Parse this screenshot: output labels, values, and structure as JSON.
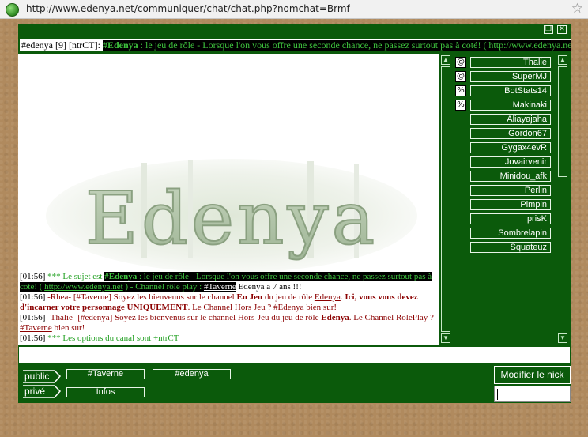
{
  "address_bar": {
    "url": "http://www.edenya.net/communiquer/chat/chat.php?nomchat=Brmf"
  },
  "window": {
    "restore_glyph": "❐",
    "close_glyph": "✕"
  },
  "topic": {
    "prefix": "#edenya [9] [ntrCT]: ",
    "channel": "#Edenya",
    "text": " : le jeu de rôle - Lorsque l'on vous offre une seconde chance, ne passez surtout pas à coté! ( http://www.edenya.net ) "
  },
  "logo": {
    "text": "Edenya"
  },
  "messages": {
    "m1": {
      "time": "[01:56]",
      "pre": " *** Le sujet est ",
      "channel": "#Edenya",
      "topic": " : le jeu de rôle - Lorsque l'on vous offre une seconde chance, ne passez surtout pas à coté! ( ",
      "url": "http://www.edenya.net",
      "mid": " ) - Channel rôle play : ",
      "taverne": "#Taverne",
      "end": " Edenya a 7 ans !!!"
    },
    "m2": {
      "time": "[01:56]",
      "nick": " -Rhea- ",
      "a": "[#Taverne] Soyez les bienvenus sur le channel ",
      "b1": "En Jeu",
      "c": " du jeu de rôle ",
      "d": "Edenya",
      "e": ". ",
      "f": "Ici, vous vous devez d'incarner votre personnage UNIQUEMENT",
      "g": ". Le Channel Hors Jeu ? #Edenya bien sur!"
    },
    "m3": {
      "time": "[01:56]",
      "nick": " -Thalie- ",
      "a": "[#edenya] Soyez les bienvenus sur le channel Hors-Jeu du jeu de rôle ",
      "b1": "Edenya",
      "c": ". Le Channel RolePlay ? ",
      "d": "#Taverne",
      "e": " bien sur!"
    },
    "m4": {
      "time": "[01:56]",
      "text": " *** Les options du canal sont +ntrCT"
    }
  },
  "users": [
    {
      "badge": "@",
      "name": "Thalie"
    },
    {
      "badge": "@",
      "name": "SuperMJ"
    },
    {
      "badge": "%",
      "name": "BotStats14"
    },
    {
      "badge": "%",
      "name": "Makinaki"
    },
    {
      "badge": "",
      "name": "Aliayajaha"
    },
    {
      "badge": "",
      "name": "Gordon67"
    },
    {
      "badge": "",
      "name": "Gygax4evR"
    },
    {
      "badge": "",
      "name": "Jovairvenir"
    },
    {
      "badge": "",
      "name": "Minidou_afk"
    },
    {
      "badge": "",
      "name": "Perlin"
    },
    {
      "badge": "",
      "name": "Pimpin"
    },
    {
      "badge": "",
      "name": "prisK"
    },
    {
      "badge": "",
      "name": "Sombrelapin"
    },
    {
      "badge": "",
      "name": "Squateuz"
    }
  ],
  "bottom": {
    "public_label": "public",
    "public_channels": [
      "#Taverne",
      "#edenya"
    ],
    "private_label": "privé",
    "private_channels": [
      "Infos"
    ],
    "nick_button": "Modifier le nick"
  },
  "colors": {
    "panel_green": "#0b5a0b",
    "link_green": "#1f9f1f",
    "highlight_green": "#3ec33e",
    "dark_red": "#8b0000",
    "wood": "#b08a5e"
  },
  "icons": {
    "globe": "globe-icon",
    "star": "bookmark-star-icon",
    "scroll_up": "chevron-up-icon",
    "scroll_down": "chevron-down-icon"
  }
}
